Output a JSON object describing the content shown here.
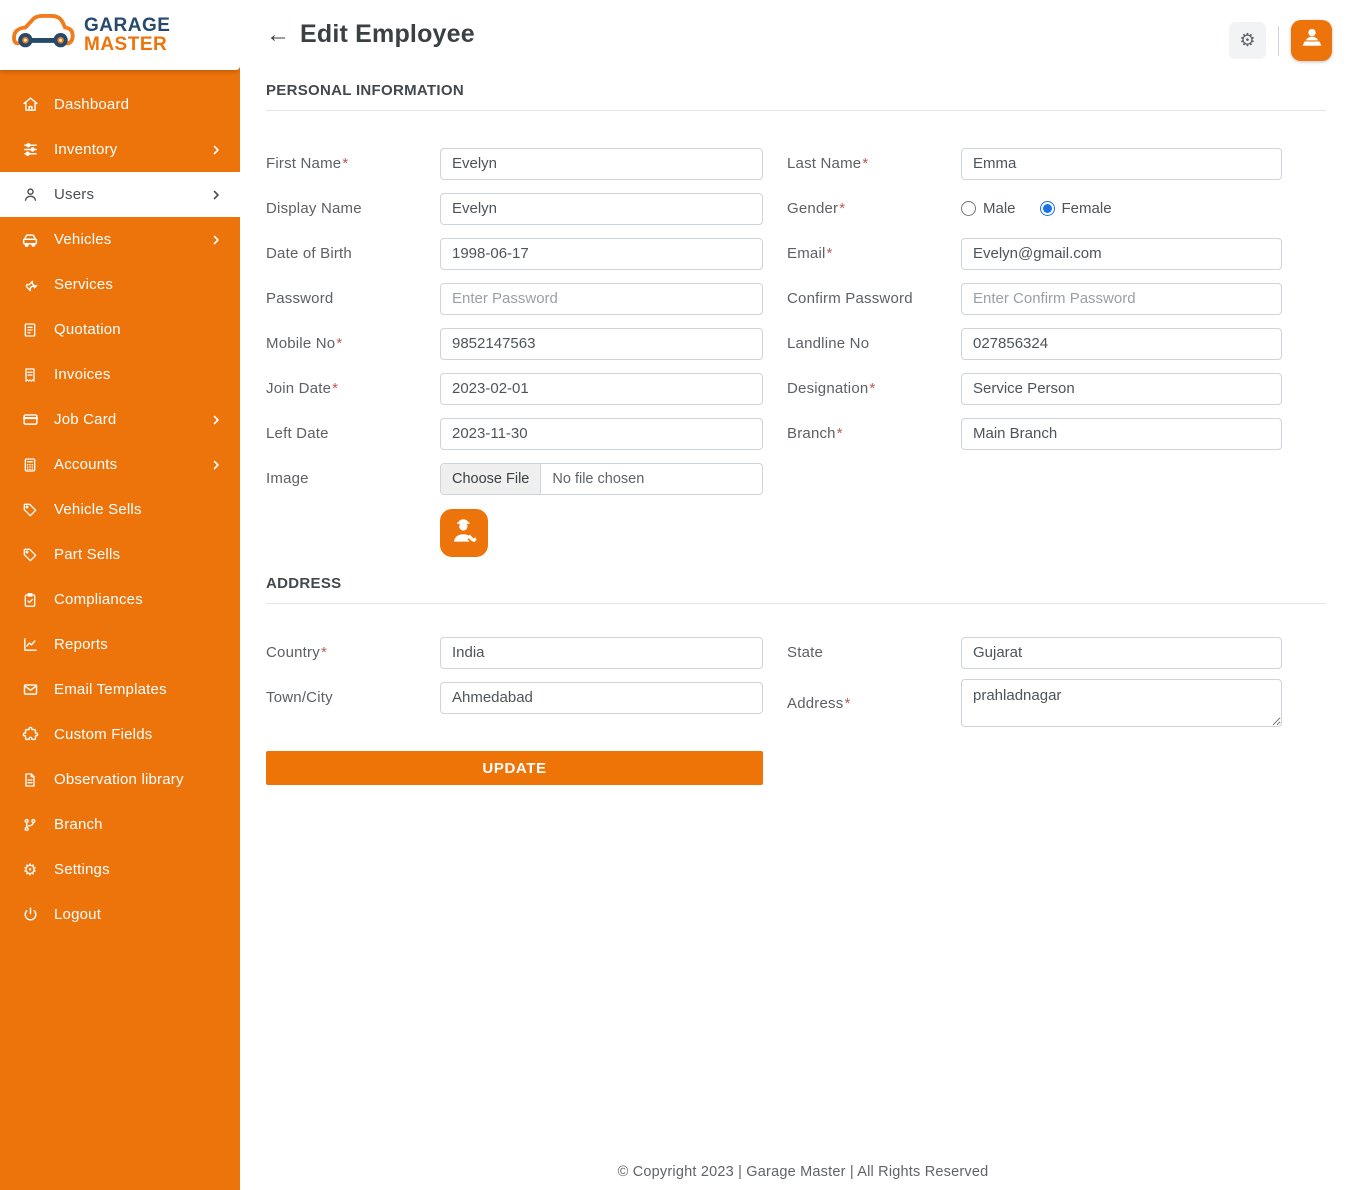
{
  "brand": {
    "line1": "GARAGE",
    "line2": "MASTER"
  },
  "topbar": {
    "back_arrow": "←",
    "title": "Edit Employee",
    "settings_icon": "⚙"
  },
  "sidebar": {
    "items": [
      {
        "label": "Dashboard",
        "icon": "home",
        "chevron": false,
        "active": false
      },
      {
        "label": "Inventory",
        "icon": "sliders",
        "chevron": true,
        "active": false
      },
      {
        "label": "Users",
        "icon": "user",
        "chevron": true,
        "active": true
      },
      {
        "label": "Vehicles",
        "icon": "car",
        "chevron": true,
        "active": false
      },
      {
        "label": "Services",
        "icon": "wrench",
        "chevron": false,
        "active": false
      },
      {
        "label": "Quotation",
        "icon": "file-invoice",
        "chevron": false,
        "active": false
      },
      {
        "label": "Invoices",
        "icon": "receipt",
        "chevron": false,
        "active": false
      },
      {
        "label": "Job Card",
        "icon": "credit-card",
        "chevron": true,
        "active": false
      },
      {
        "label": "Accounts",
        "icon": "calculator",
        "chevron": true,
        "active": false
      },
      {
        "label": "Vehicle Sells",
        "icon": "tag",
        "chevron": false,
        "active": false
      },
      {
        "label": "Part Sells",
        "icon": "tag",
        "chevron": false,
        "active": false
      },
      {
        "label": "Compliances",
        "icon": "clipboard-check",
        "chevron": false,
        "active": false
      },
      {
        "label": "Reports",
        "icon": "chart-line",
        "chevron": false,
        "active": false
      },
      {
        "label": "Email Templates",
        "icon": "envelope",
        "chevron": false,
        "active": false
      },
      {
        "label": "Custom Fields",
        "icon": "puzzle",
        "chevron": false,
        "active": false
      },
      {
        "label": "Observation library",
        "icon": "file",
        "chevron": false,
        "active": false
      },
      {
        "label": "Branch",
        "icon": "git-branch",
        "chevron": false,
        "active": false
      },
      {
        "label": "Settings",
        "icon": "gear",
        "chevron": false,
        "active": false
      },
      {
        "label": "Logout",
        "icon": "power",
        "chevron": false,
        "active": false
      }
    ]
  },
  "sections": {
    "personal": "PERSONAL INFORMATION",
    "address": "ADDRESS"
  },
  "form": {
    "first_name": {
      "label": "First Name",
      "req": "*",
      "value": "Evelyn"
    },
    "display_name": {
      "label": "Display Name",
      "req": "",
      "value": "Evelyn"
    },
    "dob": {
      "label": "Date of Birth",
      "req": "",
      "value": "1998-06-17"
    },
    "password": {
      "label": "Password",
      "req": "",
      "placeholder": "Enter Password"
    },
    "mobile": {
      "label": "Mobile No",
      "req": "*",
      "value": "9852147563"
    },
    "join_date": {
      "label": "Join Date",
      "req": "*",
      "value": "2023-02-01"
    },
    "left_date": {
      "label": "Left Date",
      "req": "",
      "value": "2023-11-30"
    },
    "image": {
      "label": "Image",
      "req": "",
      "button_label": "Choose File",
      "status": "No file chosen"
    },
    "last_name": {
      "label": "Last Name",
      "req": "*",
      "value": "Emma"
    },
    "gender": {
      "label": "Gender",
      "req": "*",
      "options": [
        "Male",
        "Female"
      ],
      "selected": "Female"
    },
    "email": {
      "label": "Email",
      "req": "*",
      "value": "Evelyn@gmail.com"
    },
    "confirm_password": {
      "label": "Confirm Password",
      "req": "",
      "placeholder": "Enter Confirm Password"
    },
    "landline": {
      "label": "Landline No",
      "req": "",
      "value": "027856324"
    },
    "designation": {
      "label": "Designation",
      "req": "*",
      "value": "Service Person"
    },
    "branch": {
      "label": "Branch",
      "req": "*",
      "value": "Main Branch"
    },
    "country": {
      "label": "Country",
      "req": "*",
      "value": "India"
    },
    "town": {
      "label": "Town/City",
      "req": "",
      "value": "Ahmedabad"
    },
    "state": {
      "label": "State",
      "req": "",
      "value": "Gujarat"
    },
    "address": {
      "label": "Address",
      "req": "*",
      "value": "prahladnagar"
    }
  },
  "actions": {
    "update": "UPDATE"
  },
  "footer": {
    "copyright": "© Copyright 2023 | Garage Master | All Rights Reserved"
  },
  "colors": {
    "orange": "#ED730B",
    "navy": "#26496C",
    "radio_blue": "#1A73E8",
    "active_item_bg": "#FFFFFF"
  }
}
